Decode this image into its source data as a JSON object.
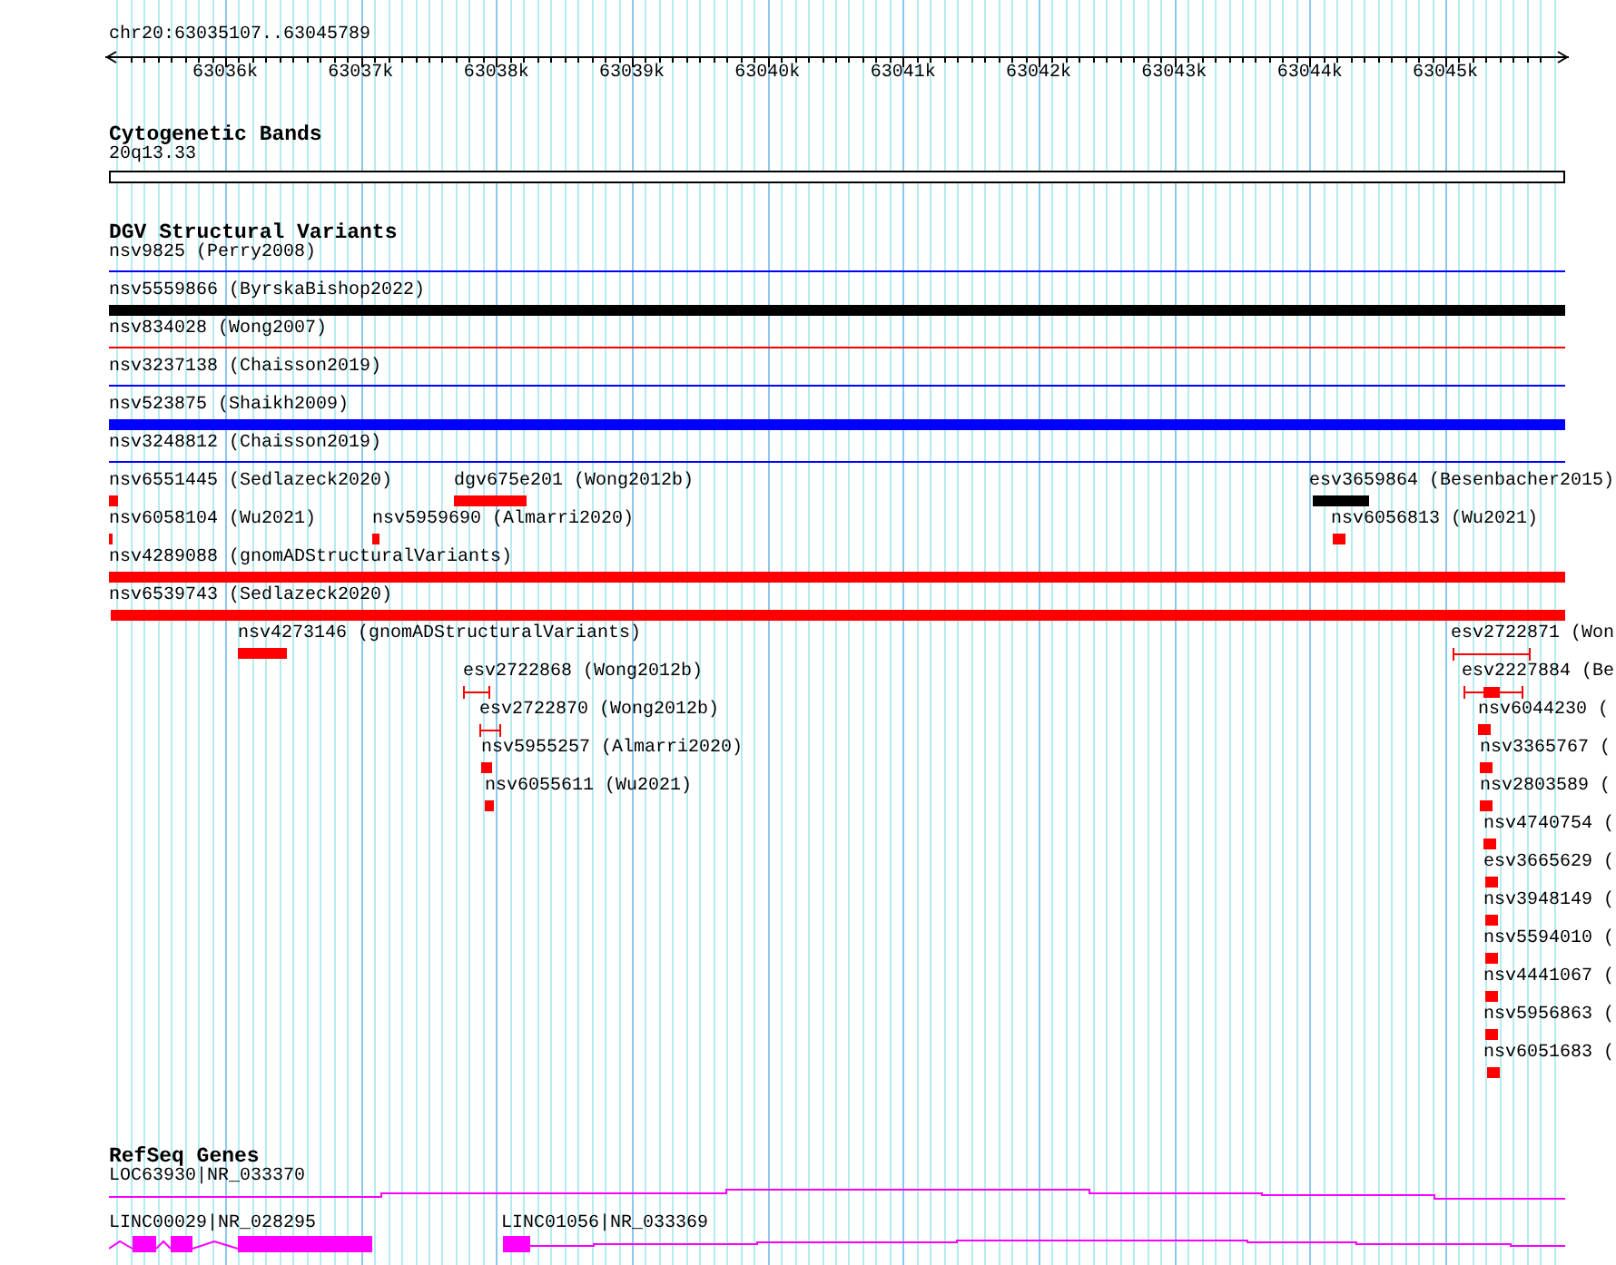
{
  "ruler": {
    "locus": "chr20:63035107..63045789",
    "ticks": [
      "63036k",
      "63037k",
      "63038k",
      "63039k",
      "63040k",
      "63041k",
      "63042k",
      "63043k",
      "63044k",
      "63045k"
    ]
  },
  "tracks": [
    {
      "title": "Cytogenetic Bands",
      "kind": "bands",
      "lanes": [
        [
          {
            "label": "20q13.33",
            "kind": "band"
          }
        ]
      ]
    },
    {
      "title": "DGV Structural Variants",
      "kind": "variants",
      "lanes": [
        [
          {
            "label": "nsv9825 (Perry2008)",
            "kind": "line",
            "color": "#0000ff"
          }
        ],
        [
          {
            "label": "nsv5559866 (ByrskaBishop2022)",
            "kind": "bar",
            "color": "#000000"
          }
        ],
        [
          {
            "label": "nsv834028 (Wong2007)",
            "kind": "line",
            "color": "#ff0000"
          }
        ],
        [
          {
            "label": "nsv3237138 (Chaisson2019)",
            "kind": "line",
            "color": "#0000ff"
          }
        ],
        [
          {
            "label": "nsv523875 (Shaikh2009)",
            "kind": "bar",
            "color": "#0000ff"
          }
        ],
        [
          {
            "label": "nsv3248812 (Chaisson2019)",
            "kind": "line",
            "color": "#0000ff"
          }
        ],
        [
          {
            "label": "nsv6551445 (Sedlazeck2020)",
            "kind": "bar",
            "color": "#ff0000"
          },
          {
            "label": "dgv675e201 (Wong2012b)",
            "kind": "bar",
            "color": "#ff0000"
          },
          {
            "label": "esv3659864 (Besenbacher2015)",
            "kind": "bar",
            "color": "#000000"
          }
        ],
        [
          {
            "label": "nsv6058104 (Wu2021)",
            "kind": "bar",
            "color": "#ff0000"
          },
          {
            "label": "nsv5959690 (Almarri2020)",
            "kind": "bar",
            "color": "#ff0000"
          },
          {
            "label": "nsv6056813 (Wu2021)",
            "kind": "bar",
            "color": "#ff0000"
          }
        ],
        [
          {
            "label": "nsv4289088 (gnomADStructuralVariants)",
            "kind": "bar",
            "color": "#ff0000"
          }
        ],
        [
          {
            "label": "nsv6539743 (Sedlazeck2020)",
            "kind": "bar",
            "color": "#ff0000"
          }
        ],
        [
          {
            "label": "nsv4273146 (gnomADStructuralVariants)",
            "kind": "bar",
            "color": "#ff0000"
          },
          {
            "label": "esv2722871 (Won",
            "kind": "whisker",
            "color": "#ff0000"
          }
        ],
        [
          {
            "label": "esv2722868 (Wong2012b)",
            "kind": "whisker",
            "color": "#ff0000"
          },
          {
            "label": "esv2227884 (Be",
            "kind": "whisker_box",
            "color": "#ff0000"
          }
        ],
        [
          {
            "label": "esv2722870 (Wong2012b)",
            "kind": "whisker",
            "color": "#ff0000"
          },
          {
            "label": "nsv6044230 (",
            "kind": "bar",
            "color": "#ff0000"
          }
        ],
        [
          {
            "label": "nsv5955257 (Almarri2020)",
            "kind": "bar",
            "color": "#ff0000"
          },
          {
            "label": "nsv3365767 (",
            "kind": "bar",
            "color": "#ff0000"
          }
        ],
        [
          {
            "label": "nsv6055611 (Wu2021)",
            "kind": "bar",
            "color": "#ff0000"
          },
          {
            "label": "nsv2803589 (",
            "kind": "bar",
            "color": "#ff0000"
          }
        ],
        [
          {
            "label": "nsv4740754 (",
            "kind": "bar",
            "color": "#ff0000"
          }
        ],
        [
          {
            "label": "esv3665629 (",
            "kind": "bar",
            "color": "#ff0000"
          }
        ],
        [
          {
            "label": "nsv3948149 (",
            "kind": "bar",
            "color": "#ff0000"
          }
        ],
        [
          {
            "label": "nsv5594010 (",
            "kind": "bar",
            "color": "#ff0000"
          }
        ],
        [
          {
            "label": "nsv4441067 (",
            "kind": "bar",
            "color": "#ff0000"
          }
        ],
        [
          {
            "label": "nsv5956863 (",
            "kind": "bar",
            "color": "#ff0000"
          }
        ],
        [
          {
            "label": "nsv6051683 (",
            "kind": "bar",
            "color": "#ff0000"
          }
        ]
      ]
    },
    {
      "title": "RefSeq Genes",
      "kind": "genes",
      "lanes": [
        [
          {
            "label": "LOC63930|NR_033370",
            "kind": "transcript"
          }
        ],
        [
          {
            "label": "LINC00029|NR_028295",
            "kind": "transcript"
          },
          {
            "label": "LINC01056|NR_033369",
            "kind": "transcript"
          }
        ]
      ]
    }
  ]
}
